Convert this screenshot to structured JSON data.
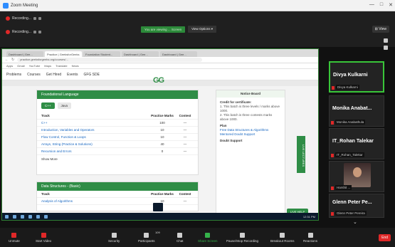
{
  "window": {
    "title": "Zoom Meeting",
    "controls": [
      "—",
      "□",
      "✕"
    ]
  },
  "top": {
    "recording_labels": [
      "Recording...",
      "Recording..."
    ],
    "share_banner": "You are viewing ... Screen",
    "options_label": "View Options ▾",
    "view_button": "⊞ View"
  },
  "browser": {
    "tabs": [
      "Dashboard | Gee...",
      "Practice | GeeksforGeeks",
      "Foundation Student...",
      "Dashboard | Gee...",
      "Dashboard | Gee..."
    ],
    "url": "practice.geeksforgeeks.org/courses/...",
    "bookmarks": [
      "Apps",
      "Gmail",
      "YouTube",
      "Maps",
      "Translate",
      "News"
    ]
  },
  "gfg": {
    "logo": "GG",
    "nav": [
      "Problems",
      "Courses",
      "Get Hired",
      "Events",
      "GFG SDE"
    ],
    "card1": {
      "title": "Foundational Language",
      "pills": [
        "C++",
        "Java"
      ],
      "headers": [
        "Track",
        "Practice Marks",
        "Contest"
      ],
      "rows": [
        [
          "C++",
          "100",
          "—"
        ],
        [
          "Introduction, Variables and Operators",
          "10",
          "—"
        ],
        [
          "Flow Control, Function & Loops",
          "10",
          "—"
        ],
        [
          "Arrays, String (Practice & Solutions)",
          "40",
          "—"
        ],
        [
          "Recursion and Errors",
          "0",
          "—"
        ]
      ],
      "show_more": "Show More"
    },
    "card2": {
      "title": "Data Structures - (Basic)",
      "headers": [
        "Track",
        "Practice Marks",
        "Contest"
      ],
      "rows": [
        [
          "Analysis of Algorithms",
          "10",
          "—"
        ]
      ]
    },
    "notice": {
      "title": "Notice Board",
      "s1": "Credit for certificate:",
      "l1": "1. This batch is three levels / marks above 1000.",
      "l2": "2. This batch is three contests marks above 1000.",
      "s2": "Plan",
      "s3": "Doubt Support",
      "l3": "Free Data Structures & Algorithms",
      "l4": "Mentored Doubt Support"
    },
    "vtab": "LIVE LECTURES",
    "chat": "LIVE HELP"
  },
  "taskbar": {
    "clock": "12:31 PM"
  },
  "participants": [
    {
      "name": "Divya Kulkarni",
      "label": "Divya Kulkarni"
    },
    {
      "name": "Monika Anabat...",
      "label": "Monika Anabathula"
    },
    {
      "name": "IT_Rohan Talekar",
      "label": "IT_Rohan_Talekar"
    },
    {
      "name": "",
      "label": "Harshit ..."
    },
    {
      "name": "Glenn Peter Pe...",
      "label": "Glenn Peter Pereira"
    }
  ],
  "toolbar": {
    "items": [
      "Unmute",
      "Start Video",
      "Security",
      "Participants",
      "Chat",
      "Share Screen",
      "Pause/Stop Recording",
      "Breakout Rooms",
      "Reactions"
    ],
    "participant_count": "109",
    "end": "End"
  }
}
